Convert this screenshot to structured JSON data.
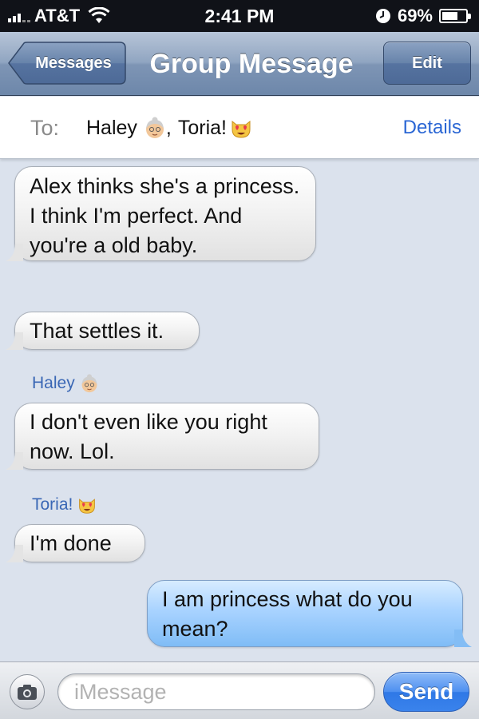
{
  "status_bar": {
    "carrier": "AT&T",
    "time": "2:41 PM",
    "battery_percent": "69%",
    "battery_level": 0.69
  },
  "nav": {
    "back_label": "Messages",
    "title": "Group Message",
    "edit_label": "Edit"
  },
  "recipients_bar": {
    "to_label": "To:",
    "recipient_1": "Haley",
    "separator": ",",
    "recipient_2": "Toria!",
    "details_label": "Details",
    "recipient_1_icon": "grandma-emoji-icon",
    "recipient_2_icon": "heart-eyes-cat-emoji-icon"
  },
  "messages": [
    {
      "direction": "incoming",
      "sender": "",
      "text": "Alex thinks she's a princess. I think I'm perfect. And you're a old baby."
    },
    {
      "direction": "incoming",
      "sender": "",
      "text": "That settles it."
    },
    {
      "direction": "incoming",
      "sender": "Haley",
      "text": "I don't even like you right now. Lol."
    },
    {
      "direction": "incoming",
      "sender": "Toria!",
      "text": "I'm done"
    },
    {
      "direction": "outgoing",
      "sender": "",
      "text": "I am princess what do you mean?"
    }
  ],
  "input_bar": {
    "placeholder": "iMessage",
    "value": "",
    "send_label": "Send"
  },
  "colors": {
    "background": "#dbe2ed",
    "link": "#2a66d4",
    "sender_name": "#3a67b5",
    "outgoing_bubble": "#a9d3ff",
    "incoming_bubble": "#f3f3f3"
  }
}
